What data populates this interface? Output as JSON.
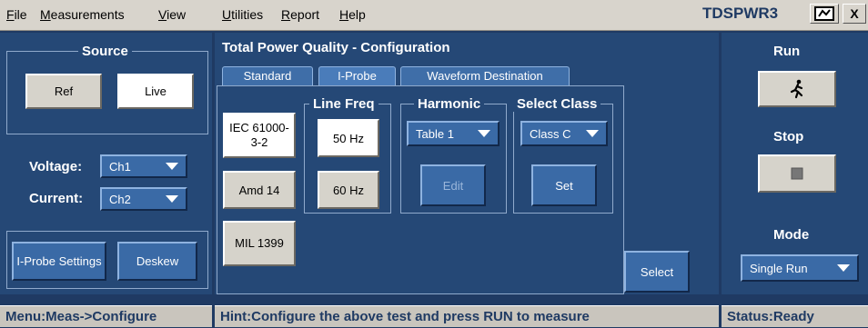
{
  "menubar": {
    "items": [
      "File",
      "Measurements",
      "View",
      "Utilities",
      "Report",
      "Help"
    ],
    "app_title": "TDSPWR3",
    "close_label": "X"
  },
  "source": {
    "title": "Source",
    "ref_label": "Ref",
    "live_label": "Live",
    "voltage_label": "Voltage:",
    "voltage_value": "Ch1",
    "current_label": "Current:",
    "current_value": "Ch2",
    "iprobe_settings_label": "I-Probe Settings",
    "deskew_label": "Deskew"
  },
  "config": {
    "title": "Total Power Quality - Configuration",
    "tabs": [
      "Standard",
      "I-Probe",
      "Waveform Destination"
    ],
    "standards": [
      "IEC 61000-3-2",
      "Amd 14",
      "MIL 1399"
    ],
    "line_freq_title": "Line Freq",
    "freq_50": "50 Hz",
    "freq_60": "60 Hz",
    "harmonic_title": "Harmonic",
    "harmonic_value": "Table 1",
    "edit_label": "Edit",
    "select_class_title": "Select Class",
    "class_value": "Class C",
    "set_label": "Set",
    "select_label": "Select"
  },
  "run_panel": {
    "run_title": "Run",
    "stop_title": "Stop",
    "mode_title": "Mode",
    "mode_value": "Single Run"
  },
  "status": {
    "menu": "Menu:Meas->Configure",
    "hint": "Hint:Configure the above test and press RUN to measure",
    "status": "Status:Ready"
  }
}
